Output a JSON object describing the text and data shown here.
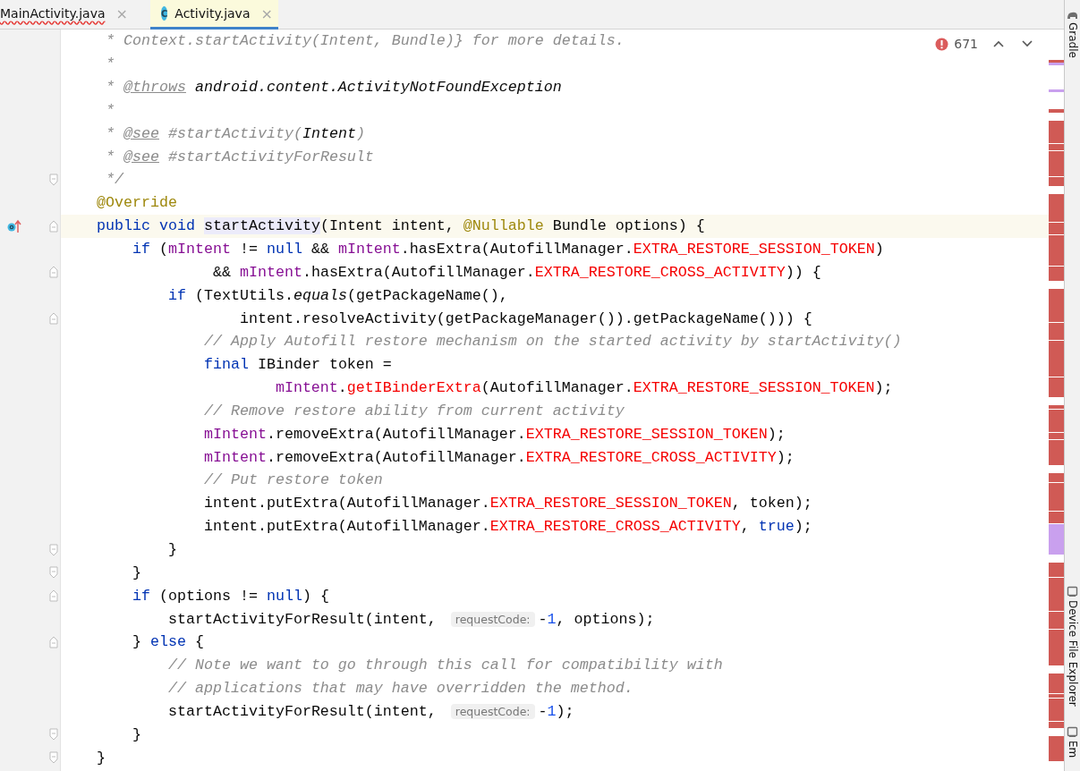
{
  "tabs": [
    {
      "label": "MainActivity.java",
      "selected": false,
      "error": true,
      "close": "×"
    },
    {
      "label": "Activity.java",
      "selected": true,
      "error": false,
      "icon_letter": "C",
      "close": "×"
    }
  ],
  "problems": {
    "count": "671"
  },
  "code_lines": [
    {
      "tokens": [
        {
          "kind": "comment",
          "text": "     * Context.startActivity(Intent, Bundle)} for more details."
        }
      ]
    },
    {
      "tokens": [
        {
          "kind": "comment",
          "text": "     *"
        }
      ]
    },
    {
      "tokens": [
        {
          "kind": "comment",
          "text": "     * "
        },
        {
          "kind": "doctag",
          "text": "@throws"
        },
        {
          "kind": "doctext",
          "text": " android.content.ActivityNotFoundException"
        }
      ]
    },
    {
      "tokens": [
        {
          "kind": "comment",
          "text": "     *"
        }
      ]
    },
    {
      "tokens": [
        {
          "kind": "comment",
          "text": "     * "
        },
        {
          "kind": "doctag",
          "text": "@see"
        },
        {
          "kind": "comment",
          "text": " #startActivity("
        },
        {
          "kind": "doctext",
          "text": "Intent"
        },
        {
          "kind": "comment",
          "text": ")"
        }
      ]
    },
    {
      "tokens": [
        {
          "kind": "comment",
          "text": "     * "
        },
        {
          "kind": "doctag",
          "text": "@see"
        },
        {
          "kind": "comment",
          "text": " #startActivityForResult"
        }
      ]
    },
    {
      "fold_end": true,
      "tokens": [
        {
          "kind": "comment",
          "text": "     */"
        }
      ]
    },
    {
      "tokens": [
        {
          "kind": "annotation",
          "text": "    @Override"
        }
      ]
    },
    {
      "fold_start": true,
      "overrides_marker": true,
      "current": true,
      "tokens": [
        {
          "kind": "keyword",
          "text": "    public void "
        },
        {
          "kind": "declaration",
          "text": "startActivity"
        },
        {
          "kind": "plain",
          "text": "(Intent intent, "
        },
        {
          "kind": "annotation",
          "text": "@Nullable"
        },
        {
          "kind": "plain",
          "text": " Bundle options) {"
        }
      ]
    },
    {
      "tokens": [
        {
          "kind": "keyword",
          "text": "        if"
        },
        {
          "kind": "plain",
          "text": " ("
        },
        {
          "kind": "field",
          "text": "mIntent"
        },
        {
          "kind": "plain",
          "text": " != "
        },
        {
          "kind": "keyword",
          "text": "null"
        },
        {
          "kind": "plain",
          "text": " && "
        },
        {
          "kind": "field",
          "text": "mIntent"
        },
        {
          "kind": "plain",
          "text": ".hasExtra(AutofillManager."
        },
        {
          "kind": "error",
          "text": "EXTRA_RESTORE_SESSION_TOKEN"
        },
        {
          "kind": "plain",
          "text": ")"
        }
      ]
    },
    {
      "fold_start": true,
      "tokens": [
        {
          "kind": "plain",
          "text": "                 && "
        },
        {
          "kind": "field",
          "text": "mIntent"
        },
        {
          "kind": "plain",
          "text": ".hasExtra(AutofillManager."
        },
        {
          "kind": "error",
          "text": "EXTRA_RESTORE_CROSS_ACTIVITY"
        },
        {
          "kind": "plain",
          "text": ")) {"
        }
      ]
    },
    {
      "tokens": [
        {
          "kind": "keyword",
          "text": "            if"
        },
        {
          "kind": "plain",
          "text": " (TextUtils."
        },
        {
          "kind": "static",
          "text": "equals"
        },
        {
          "kind": "plain",
          "text": "(getPackageName(),"
        }
      ]
    },
    {
      "fold_start": true,
      "tokens": [
        {
          "kind": "plain",
          "text": "                    intent.resolveActivity(getPackageManager()).getPackageName())) {"
        }
      ]
    },
    {
      "tokens": [
        {
          "kind": "comment",
          "text": "                // Apply Autofill restore mechanism on the started activity by startActivity()"
        }
      ]
    },
    {
      "tokens": [
        {
          "kind": "keyword",
          "text": "                final"
        },
        {
          "kind": "plain",
          "text": " IBinder token ="
        }
      ]
    },
    {
      "tokens": [
        {
          "kind": "field",
          "text": "                        mIntent"
        },
        {
          "kind": "plain",
          "text": "."
        },
        {
          "kind": "error",
          "text": "getIBinderExtra"
        },
        {
          "kind": "plain",
          "text": "(AutofillManager."
        },
        {
          "kind": "error",
          "text": "EXTRA_RESTORE_SESSION_TOKEN"
        },
        {
          "kind": "plain",
          "text": ");"
        }
      ]
    },
    {
      "tokens": [
        {
          "kind": "comment",
          "text": "                // Remove restore ability from current activity"
        }
      ]
    },
    {
      "tokens": [
        {
          "kind": "field",
          "text": "                mIntent"
        },
        {
          "kind": "plain",
          "text": ".removeExtra(AutofillManager."
        },
        {
          "kind": "error",
          "text": "EXTRA_RESTORE_SESSION_TOKEN"
        },
        {
          "kind": "plain",
          "text": ");"
        }
      ]
    },
    {
      "tokens": [
        {
          "kind": "field",
          "text": "                mIntent"
        },
        {
          "kind": "plain",
          "text": ".removeExtra(AutofillManager."
        },
        {
          "kind": "error",
          "text": "EXTRA_RESTORE_CROSS_ACTIVITY"
        },
        {
          "kind": "plain",
          "text": ");"
        }
      ]
    },
    {
      "tokens": [
        {
          "kind": "comment",
          "text": "                // Put restore token"
        }
      ]
    },
    {
      "tokens": [
        {
          "kind": "plain",
          "text": "                intent.putExtra(AutofillManager."
        },
        {
          "kind": "error",
          "text": "EXTRA_RESTORE_SESSION_TOKEN"
        },
        {
          "kind": "plain",
          "text": ", token);"
        }
      ]
    },
    {
      "tokens": [
        {
          "kind": "plain",
          "text": "                intent.putExtra(AutofillManager."
        },
        {
          "kind": "error",
          "text": "EXTRA_RESTORE_CROSS_ACTIVITY"
        },
        {
          "kind": "plain",
          "text": ", "
        },
        {
          "kind": "keyword",
          "text": "true"
        },
        {
          "kind": "plain",
          "text": ");"
        }
      ]
    },
    {
      "fold_end": true,
      "tokens": [
        {
          "kind": "plain",
          "text": "            }"
        }
      ]
    },
    {
      "fold_end": true,
      "tokens": [
        {
          "kind": "plain",
          "text": "        }"
        }
      ]
    },
    {
      "fold_start": true,
      "tokens": [
        {
          "kind": "keyword",
          "text": "        if"
        },
        {
          "kind": "plain",
          "text": " (options != "
        },
        {
          "kind": "keyword",
          "text": "null"
        },
        {
          "kind": "plain",
          "text": ") {"
        }
      ]
    },
    {
      "tokens": [
        {
          "kind": "plain",
          "text": "            startActivityForResult(intent, "
        },
        {
          "kind": "hint",
          "text": "requestCode:"
        },
        {
          "kind": "plain",
          "text": "-"
        },
        {
          "kind": "number",
          "text": "1"
        },
        {
          "kind": "plain",
          "text": ", options);"
        }
      ]
    },
    {
      "fold_start": true,
      "tokens": [
        {
          "kind": "plain",
          "text": "        } "
        },
        {
          "kind": "keyword",
          "text": "else"
        },
        {
          "kind": "plain",
          "text": " {"
        }
      ]
    },
    {
      "tokens": [
        {
          "kind": "comment",
          "text": "            // Note we want to go through this call for compatibility with"
        }
      ]
    },
    {
      "tokens": [
        {
          "kind": "comment",
          "text": "            // applications that may have overridden the method."
        }
      ]
    },
    {
      "tokens": [
        {
          "kind": "plain",
          "text": "            startActivityForResult(intent, "
        },
        {
          "kind": "hint",
          "text": "requestCode:"
        },
        {
          "kind": "plain",
          "text": "-"
        },
        {
          "kind": "number",
          "text": "1"
        },
        {
          "kind": "plain",
          "text": ");"
        }
      ]
    },
    {
      "fold_end": true,
      "tokens": [
        {
          "kind": "plain",
          "text": "        }"
        }
      ]
    },
    {
      "fold_end": true,
      "tokens": [
        {
          "kind": "plain",
          "text": "    }"
        }
      ]
    }
  ],
  "tool_windows": [
    {
      "label": "Gradle",
      "kind": "gradle"
    },
    {
      "label": "Device File Explorer",
      "kind": "device"
    },
    {
      "label": "Em",
      "kind": "device"
    }
  ]
}
